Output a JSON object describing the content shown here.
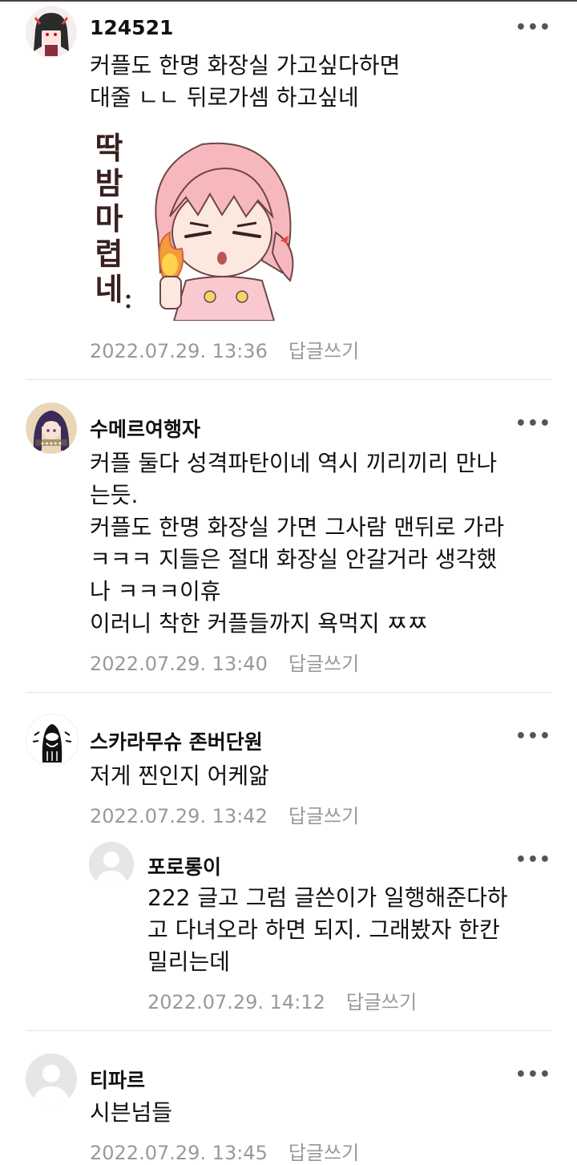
{
  "comments": [
    {
      "author": "124521",
      "text": "커플도 한명 화장실 가고싶다하면\n대줄 ㄴㄴ 뒤로가셈 하고싶네",
      "sticker_text": "딱밤마렵네..",
      "date": "2022.07.29. 13:36",
      "reply_label": "답글쓰기"
    },
    {
      "author": "수메르여행자",
      "text": "커플 둘다 성격파탄이네 역시 끼리끼리 만나\n는듯.\n커플도 한명 화장실 가면 그사람 맨뒤로 가라\nㅋㅋㅋ 지들은 절대 화장실 안갈거라 생각했\n나 ㅋㅋㅋ이휴\n이러니 착한 커플들까지 욕먹지 ㅉㅉ",
      "date": "2022.07.29. 13:40",
      "reply_label": "답글쓰기"
    },
    {
      "author": "스카라무슈 존버단원",
      "text": "저게 찐인지 어케앎",
      "date": "2022.07.29. 13:42",
      "reply_label": "답글쓰기"
    },
    {
      "author": "포로롱이",
      "text": "222 글고 그럼 글쓴이가 일행해준다하\n고 다녀오라 하면 되지. 그래봤자 한칸\n밀리는데",
      "date": "2022.07.29. 14:12",
      "reply_label": "답글쓰기"
    },
    {
      "author": "티파르",
      "text": "시븐넘들",
      "date": "2022.07.29. 13:45",
      "reply_label": "답글쓰기"
    }
  ],
  "more_icon": "more-horizontal-icon",
  "more_glyph": "•••",
  "colors": {
    "meta": "#999999",
    "divider": "#e5e5e5",
    "placeholder_avatar": "#e6e6e6"
  }
}
